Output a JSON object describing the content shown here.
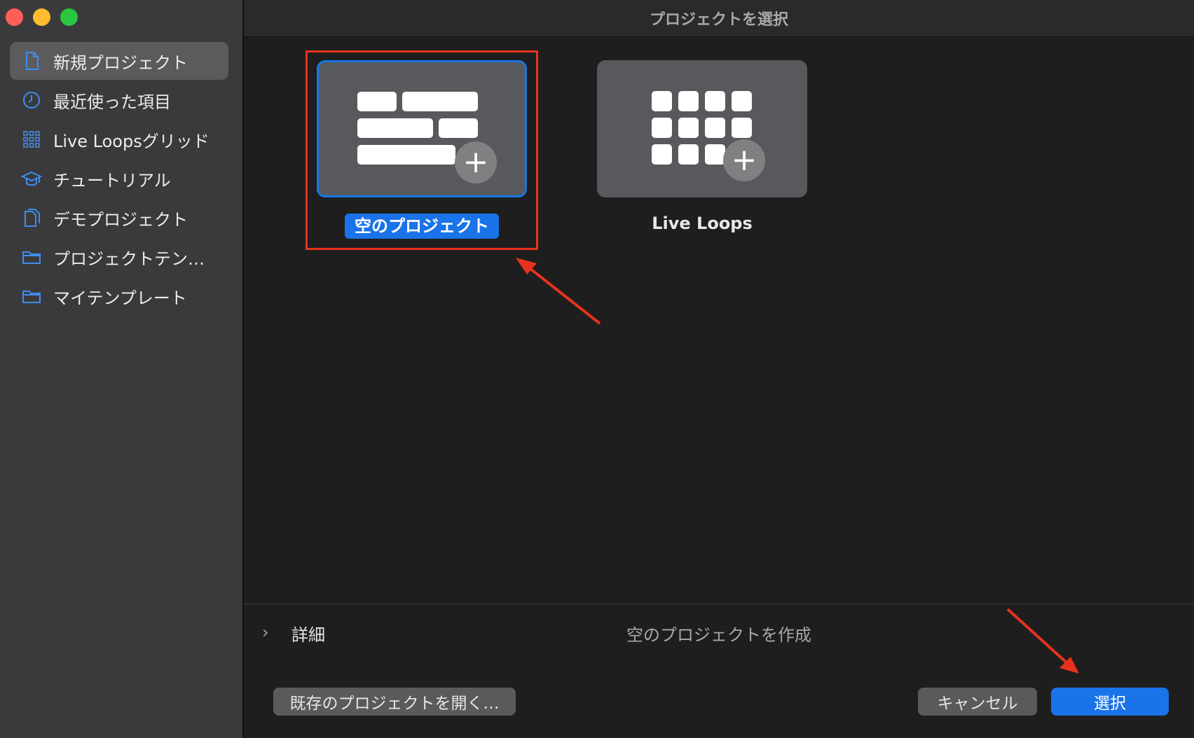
{
  "window": {
    "title": "プロジェクトを選択"
  },
  "sidebar": {
    "items": [
      {
        "label": "新規プロジェクト",
        "icon": "document-icon",
        "selected": true
      },
      {
        "label": "最近使った項目",
        "icon": "clock-icon",
        "selected": false
      },
      {
        "label": "Live Loopsグリッド",
        "icon": "grid-icon",
        "selected": false
      },
      {
        "label": "チュートリアル",
        "icon": "graduation-cap-icon",
        "selected": false
      },
      {
        "label": "デモプロジェクト",
        "icon": "documents-icon",
        "selected": false
      },
      {
        "label": "プロジェクトテン…",
        "icon": "folder-icon",
        "selected": false
      },
      {
        "label": "マイテンプレート",
        "icon": "folder-icon",
        "selected": false
      }
    ]
  },
  "templates": [
    {
      "label": "空のプロジェクト",
      "icon": "tracks-plus-icon",
      "selected": true
    },
    {
      "label": "Live Loops",
      "icon": "loops-grid-plus-icon",
      "selected": false
    }
  ],
  "details": {
    "toggle_label": "詳細",
    "description": "空のプロジェクトを作成"
  },
  "footer": {
    "open_existing_label": "既存のプロジェクトを開く…",
    "cancel_label": "キャンセル",
    "choose_label": "選択"
  },
  "colors": {
    "accent": "#1a73e8",
    "annotation": "#e8321d",
    "sidebar_bg": "#3a3a3c",
    "main_bg": "#1e1e1e"
  }
}
